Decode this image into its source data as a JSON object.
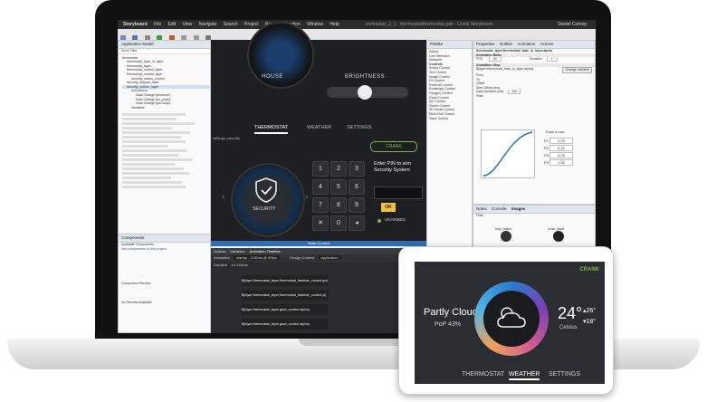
{
  "ide": {
    "menu": [
      "Storyboard",
      "File",
      "Edit",
      "View",
      "Navigate",
      "Search",
      "Project",
      "Run",
      "Animation",
      "Window",
      "Help"
    ],
    "title": "wohnplatz_2_1 - thermostat/thermostat.gde - Crank Storyboard",
    "user": "Daniel Conroy",
    "left_panel_title": "Application Model",
    "left_panel_filter": "None Filter",
    "tree": [
      "thermostat",
      "thermostat_fade_in_layer",
      "thermostat_layer",
      "thermostat_control_layer",
      "thermostat_control_layer",
      "security_status_control",
      "security_keypad_layer",
      "security_screen_layer",
      "Animations",
      "Data Change fpsframe2",
      "Data Change fps_ymin2",
      "Data Change fpsComp2",
      "Variables"
    ],
    "canvas": {
      "house_label": "HOUSE",
      "brightness_label": "BRIGHTNESS",
      "tabs": [
        "THERMOSTAT",
        "WEATHER",
        "SETTINGS"
      ],
      "screen_label": "settings_security",
      "security_label": "SECURITY",
      "crank_label": "CRANK",
      "pin_prompt": "Enter PIN to arm Security System",
      "ok_label": "OK",
      "unarmed_label": "UNARMED",
      "keys": [
        "1",
        "2",
        "3",
        "4",
        "5",
        "6",
        "7",
        "8",
        "9",
        "✕",
        "0",
        "◂"
      ]
    },
    "status_bar": "State Context",
    "palette": {
      "title": "Palette",
      "items": [
        "Select",
        "Line Selection",
        "Marquee",
        "Controls",
        "Empty Control",
        "Text Control",
        "Image Control",
        "Fill Control",
        "External Control",
        "Rectangle Control",
        "Polygon Control",
        "Circle Control",
        "Arc Control",
        "Scene Control",
        "3D Model Control",
        "Multi-Text Control",
        "Table Control"
      ]
    },
    "properties": {
      "tabs": [
        "Properties",
        "Outline",
        "Animation",
        "Actions"
      ],
      "header": "thermostat: layer.thermostat_fade_in_layer.alpha",
      "section_a": "Animation Basic",
      "fps_label": "FPS",
      "fps_value": "60",
      "duration_label": "Duration",
      "duration_value": "1",
      "section_b": "Animation Step",
      "variable": "${layer:thermostat_fade_in_layer.alpha}",
      "change_variable": "Change Variable",
      "from_value_label": "From",
      "to_value_label": "To",
      "offset_label": "Offset",
      "start_offset_label": "Start Offset (ms)",
      "data_duration_label": "Data Duration (ms)",
      "data_duration_value": "250",
      "rate_label": "Rate",
      "ease_label": "Ease in-out",
      "curve_fields": [
        {
          "label": "P1",
          "value": "0.25"
        },
        {
          "label": "P2",
          "value": "0.10"
        },
        {
          "label": "P3",
          "value": "0.25"
        },
        {
          "label": "P4",
          "value": "1.00"
        }
      ]
    },
    "images": {
      "tabs": [
        "Notes",
        "Console",
        "Images"
      ],
      "filter_label": "Filter",
      "items": [
        "help_button",
        "circle_black",
        "circle_grey",
        "circle_glow",
        "circle_red",
        "circle_blue"
      ]
    },
    "components": {
      "title": "Components",
      "available": "Available Components",
      "link": "Add components to this project...",
      "preview": "Component Preview",
      "no_preview": "No Preview Available"
    },
    "timeline": {
      "tabs": [
        "Actions",
        "Variables",
        "Animation Timeline"
      ],
      "animation_label": "Animation",
      "animation_value": "startup - 0.00ms @ 60fps",
      "context_label": "Design Context",
      "context_value": "application",
      "duration_label": "Duration",
      "duration_value": "1s 0.00ms",
      "rows": [
        "${layer:thermostat_layer.thermostat_fadebar_control.grd_fill}",
        "${layer:thermostat_layer.thermostat_fadebar_control.yl}",
        "${layer:thermostat_layer.glow_control.alpha}",
        "${layer:thermostat_layer.glow_control.alpha}"
      ]
    }
  },
  "device": {
    "brand": "CRANK",
    "condition": "Partly Cloudy",
    "pop": "PoP 43%",
    "temperature": "24°",
    "unit": "Celsius",
    "high": "26°",
    "low": "18°",
    "tabs": [
      "THERMOSTAT",
      "WEATHER",
      "SETTINGS"
    ],
    "active_tab": "WEATHER"
  },
  "colors": {
    "accent_blue": "#2c6fb3",
    "crank_green": "#7ab648",
    "device_screen": "#2a2d31"
  }
}
